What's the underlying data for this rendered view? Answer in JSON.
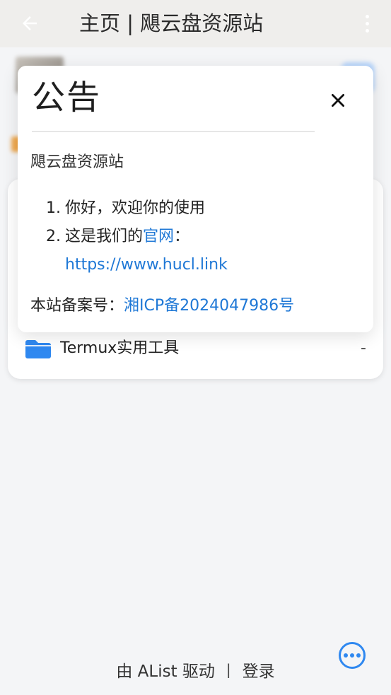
{
  "appbar": {
    "back_icon": "arrow-left-icon",
    "title": "主页 | 飓云盘资源站",
    "more_icon": "more-vert-icon"
  },
  "file_list": {
    "folder": {
      "icon": "folder-icon",
      "name": "Termux实用工具",
      "size": "-"
    }
  },
  "notice_modal": {
    "title": "公告",
    "close_icon": "close-icon",
    "subtitle": "飓云盘资源站",
    "items": [
      {
        "num": "1.",
        "text": "你好，欢迎你的使用"
      },
      {
        "num": "2.",
        "text_before": "这是我们的",
        "link_text": "官网",
        "text_after": "：",
        "url": "https://www.hucl.link"
      }
    ],
    "icp_label": "本站备案号：",
    "icp_link": "湘ICP备2024047986号"
  },
  "footer": {
    "powered_by": "由 AList 驱动",
    "separator": "|",
    "login": "登录",
    "fab_icon": "more-horizontal-icon"
  },
  "colors": {
    "appbar_bg": "#efeeec",
    "page_bg": "#f4f5f7",
    "link": "#1f78d6",
    "accent": "#2f88f0",
    "folder": "#2f88f0"
  }
}
